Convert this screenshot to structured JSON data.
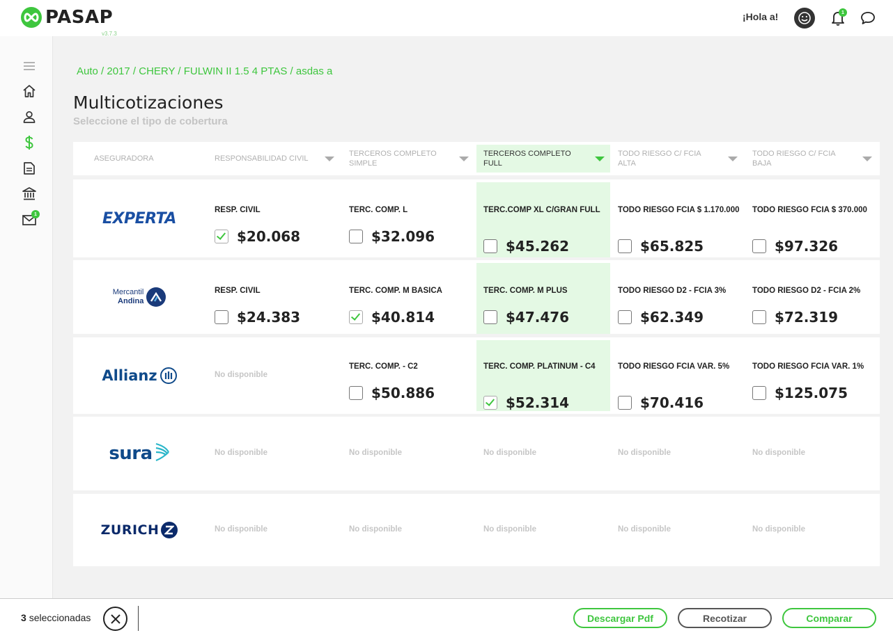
{
  "app": {
    "brand": "PASAP",
    "version": "v3.7.3",
    "greeting": "¡Hola a!",
    "notifications_count": "1",
    "accent_color": "#3ec63e"
  },
  "sidebar": {
    "items": [
      {
        "name": "menu-icon"
      },
      {
        "name": "home-icon"
      },
      {
        "name": "user-icon"
      },
      {
        "name": "dollar-icon",
        "active": true
      },
      {
        "name": "document-icon"
      },
      {
        "name": "bank-icon"
      },
      {
        "name": "mail-icon",
        "badge": "1"
      }
    ],
    "mail_badge": "1"
  },
  "breadcrumb": "Auto / 2017 / CHERY / FULWIN II 1.5 4 PTAS / asdas a",
  "title": "Multicotizaciones",
  "subtitle": "Seleccione el tipo de cobertura",
  "columns": {
    "insurer": "ASEGURADORA",
    "c1": "RESPONSABILIDAD CIVIL",
    "c2": "TERCEROS COMPLETO SIMPLE",
    "c3": "TERCEROS COMPLETO FULL",
    "c4": "TODO RIESGO C/ FCIA ALTA",
    "c5": "TODO RIESGO C/ FCIA BAJA"
  },
  "rows": {
    "experta": {
      "insurer": "EXPERTA",
      "c1": {
        "name": "RESP. CIVIL",
        "price": "$20.068",
        "checked": true
      },
      "c2": {
        "name": "TERC. COMP. L",
        "price": "$32.096",
        "checked": false
      },
      "c3": {
        "name": "TERC.COMP XL C/GRAN FULL",
        "price": "$45.262",
        "checked": false
      },
      "c4": {
        "name": "TODO RIESGO FCIA $ 1.170.000",
        "price": "$65.825",
        "checked": false
      },
      "c5": {
        "name": "TODO RIESGO FCIA $ 370.000",
        "price": "$97.326",
        "checked": false
      }
    },
    "mercantil": {
      "insurer_line1": "Mercantil",
      "insurer_line2": "Andina",
      "c1": {
        "name": "RESP. CIVIL",
        "price": "$24.383",
        "checked": false
      },
      "c2": {
        "name": "TERC. COMP. M BASICA",
        "price": "$40.814",
        "checked": true
      },
      "c3": {
        "name": "TERC. COMP. M PLUS",
        "price": "$47.476",
        "checked": false
      },
      "c4": {
        "name": "TODO RIESGO D2 - FCIA 3%",
        "price": "$62.349",
        "checked": false
      },
      "c5": {
        "name": "TODO RIESGO D2 - FCIA 2%",
        "price": "$72.319",
        "checked": false
      }
    },
    "allianz": {
      "insurer": "Allianz",
      "c1": {
        "na": "No disponible"
      },
      "c2": {
        "name": "TERC. COMP. - C2",
        "price": "$50.886",
        "checked": false
      },
      "c3": {
        "name": "TERC. COMP. PLATINUM - C4",
        "price": "$52.314",
        "checked": true
      },
      "c4": {
        "name": "TODO RIESGO FCIA VAR. 5%",
        "price": "$70.416",
        "checked": false
      },
      "c5": {
        "name": "TODO RIESGO FCIA VAR. 1%",
        "price": "$125.075",
        "checked": false
      }
    },
    "sura": {
      "insurer": "sura",
      "na": "No disponible"
    },
    "zurich": {
      "insurer": "ZURICH",
      "na": "No disponible"
    }
  },
  "footer": {
    "count": "3",
    "selected_label": "seleccionadas",
    "pdf_label": "Descargar Pdf",
    "recotizar_label": "Recotizar",
    "comparar_label": "Comparar"
  }
}
